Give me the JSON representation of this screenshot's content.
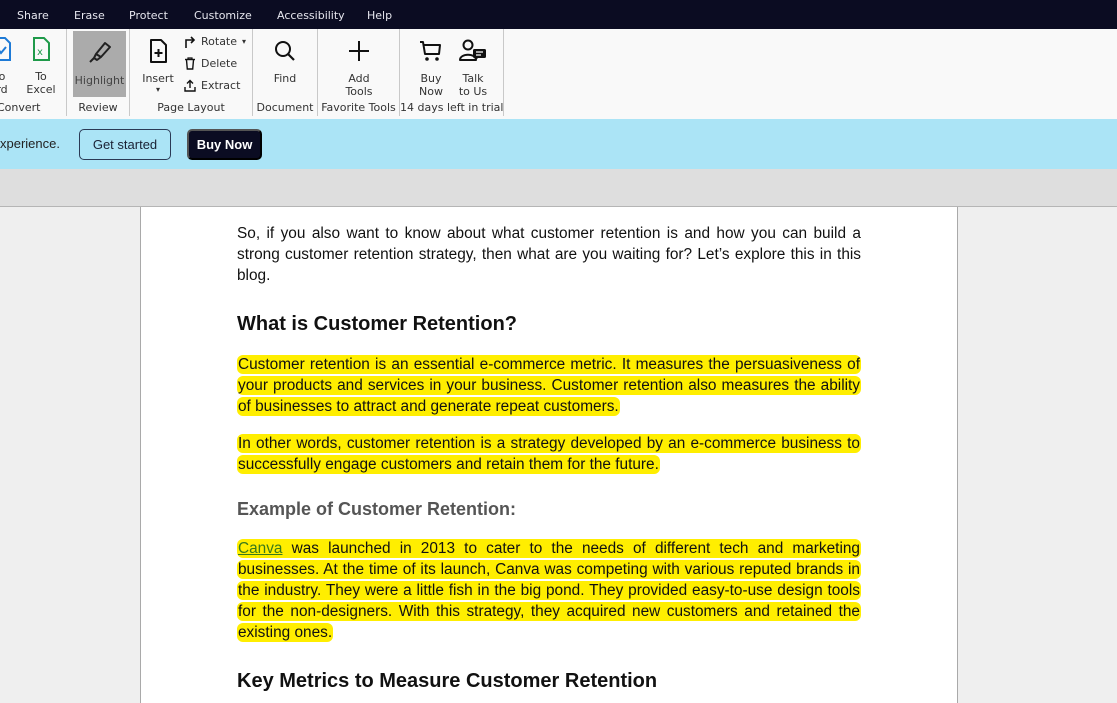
{
  "menubar": {
    "items": [
      "Share",
      "Erase",
      "Protect",
      "Customize",
      "Accessibility",
      "Help"
    ]
  },
  "ribbon": {
    "convert": {
      "to_word_label": [
        "o",
        "rd"
      ],
      "to_excel_label": [
        "To",
        "Excel"
      ],
      "group_label": "Convert"
    },
    "review": {
      "highlight_label": "Highlight",
      "group_label": "Review"
    },
    "page_layout": {
      "insert_label": "Insert",
      "rotate_label": "Rotate",
      "delete_label": "Delete",
      "extract_label": "Extract",
      "group_label": "Page Layout"
    },
    "document": {
      "find_label": "Find",
      "group_label": "Document"
    },
    "favorite_tools": {
      "add_tools_label": [
        "Add",
        "Tools"
      ],
      "group_label": "Favorite Tools"
    },
    "trial": {
      "buy_now_label": [
        "Buy",
        "Now"
      ],
      "talk_to_us_label": [
        "Talk",
        "to Us"
      ],
      "group_label": "14 days left in trial"
    }
  },
  "banner": {
    "text": "xperience.",
    "get_started_label": "Get started",
    "buy_now_label": "Buy Now"
  },
  "colors": {
    "menubar_bg": "#0b0c22",
    "banner_bg": "#abe4f6",
    "highlight": "#ffee00",
    "link": "#3a7a1a"
  },
  "document": {
    "intro": "So, if you also want to know about what customer retention is and how you can build a strong customer retention strategy, then what are you waiting for? Let’s explore this in this blog.",
    "heading1": "What is Customer Retention?",
    "para1": "Customer retention is an essential e-commerce metric. It measures the persuasiveness of your products and services in your business. Customer retention also measures the ability of businesses to attract and generate repeat customers.",
    "para2": "In other words, customer retention is a strategy developed by an e-commerce business to successfully engage customers and retain them for the future.",
    "subheading": "Example of Customer Retention:",
    "example_link": "Canva",
    "example_text": " was launched in 2013 to cater to the needs of different tech and marketing businesses. At the time of its launch, Canva was competing with various reputed brands in the industry. They were a little fish in the big pond. They provided easy-to-use design tools for the non-designers. With this strategy, they acquired new customers and retained the existing ones.",
    "heading2": "Key Metrics to Measure Customer Retention"
  }
}
